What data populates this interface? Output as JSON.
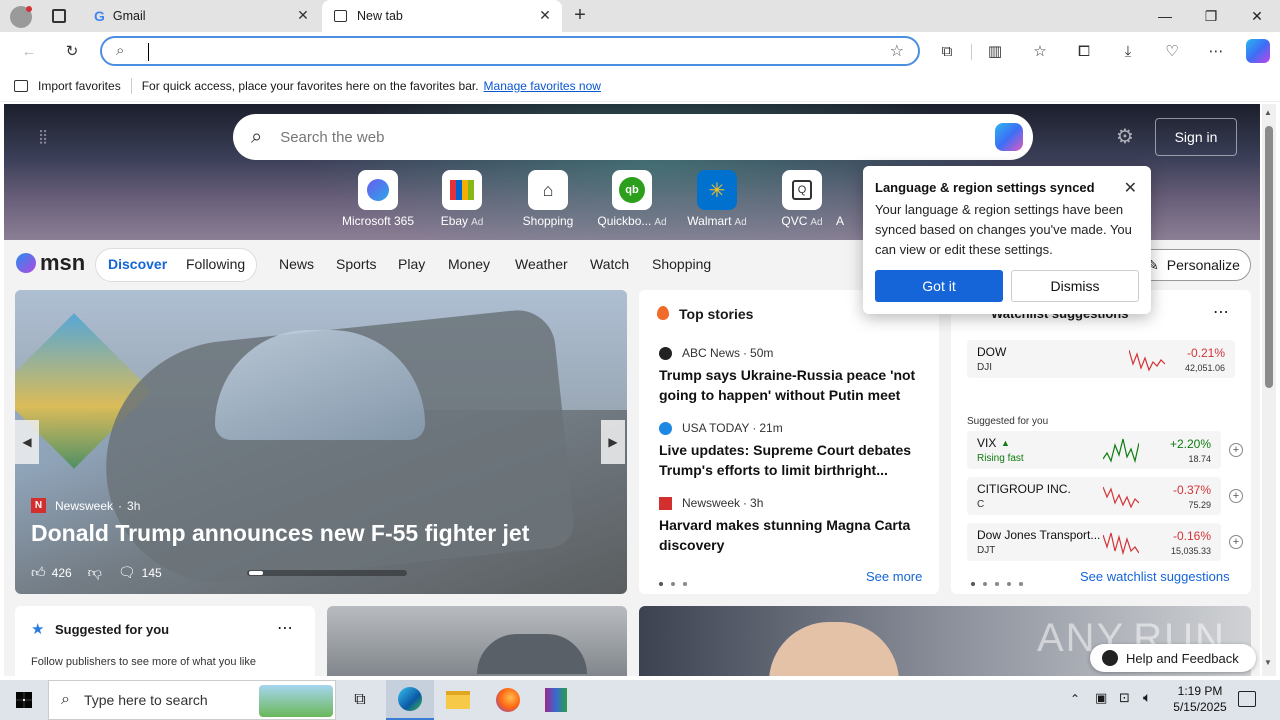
{
  "tabs": [
    {
      "title": "Gmail",
      "icon": "google-icon"
    },
    {
      "title": "New tab",
      "icon": "newtab-icon"
    }
  ],
  "favorites_bar": {
    "import_label": "Import favorites",
    "message": "For quick access, place your favorites here on the favorites bar.",
    "manage_link": "Manage favorites now"
  },
  "address_bar": {
    "value": ""
  },
  "hero": {
    "search_placeholder": "Search the web",
    "signin": "Sign in",
    "quicklinks": [
      {
        "label": "Microsoft 365",
        "ad": ""
      },
      {
        "label": "Ebay",
        "ad": "Ad"
      },
      {
        "label": "Shopping",
        "ad": ""
      },
      {
        "label": "Quickbo...",
        "ad": "Ad"
      },
      {
        "label": "Walmart",
        "ad": "Ad"
      },
      {
        "label": "QVC",
        "ad": "Ad"
      },
      {
        "label": "A",
        "ad": ""
      }
    ]
  },
  "nav": {
    "logo": "msn",
    "discover": "Discover",
    "following": "Following",
    "items": [
      "News",
      "Sports",
      "Play",
      "Money",
      "Weather",
      "Watch",
      "Shopping"
    ],
    "personalize": "Personalize"
  },
  "hero_card": {
    "source": "Newsweek",
    "time": "3h",
    "headline": "Donald Trump announces new F-55 fighter jet",
    "likes": "426",
    "comments": "145"
  },
  "top_stories": {
    "title": "Top stories",
    "stories": [
      {
        "source": "ABC News",
        "time": "50m",
        "headline": "Trump says Ukraine-Russia peace 'not going to happen' without Putin meet",
        "color": "#222222"
      },
      {
        "source": "USA TODAY",
        "time": "21m",
        "headline": "Live updates: Supreme Court debates Trump's efforts to limit birthright...",
        "color": "#1e88e5"
      },
      {
        "source": "Newsweek",
        "time": "3h",
        "headline": "Harvard makes stunning Magna Carta discovery",
        "color": "#d32f2f"
      }
    ],
    "see_more": "See more"
  },
  "watchlist": {
    "title": "Watchlist suggestions",
    "dow": {
      "name": "DOW",
      "symbol": "DJI",
      "change": "-0.21%",
      "price": "42,051.06"
    },
    "suggested_label": "Suggested for you",
    "items": [
      {
        "name": "VIX",
        "symbol": "Rising fast",
        "change": "+2.20%",
        "price": "18.74",
        "up": true
      },
      {
        "name": "CITIGROUP INC.",
        "symbol": "C",
        "change": "-0.37%",
        "price": "75.29",
        "up": false
      },
      {
        "name": "Dow Jones Transport...",
        "symbol": "DJT",
        "change": "-0.16%",
        "price": "15,035.33",
        "up": false
      }
    ],
    "see_link": "See watchlist suggestions"
  },
  "suggested": {
    "title": "Suggested for you",
    "body": "Follow publishers to see more of what you like"
  },
  "popup": {
    "title": "Language & region settings synced",
    "body": "Your language & region settings have been synced based on changes you've made. You can view or edit these settings.",
    "got_it": "Got it",
    "dismiss": "Dismiss"
  },
  "feedback": "Help and Feedback",
  "watermark": "ANY.RUN",
  "taskbar": {
    "search_placeholder": "Type here to search",
    "time": "1:19 PM",
    "date": "5/15/2025"
  },
  "colors": {
    "accent": "#1565d8",
    "negative": "#d13438",
    "positive": "#107c10"
  }
}
